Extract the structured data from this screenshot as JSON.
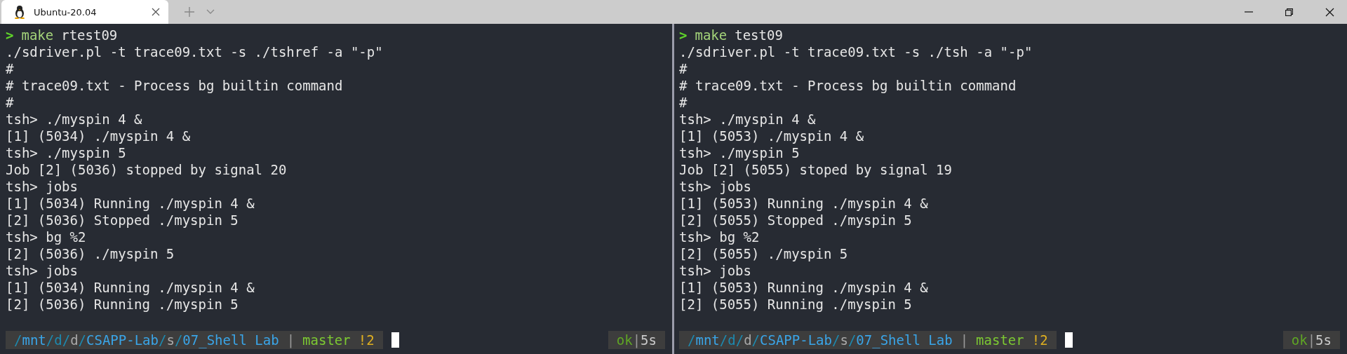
{
  "tab": {
    "title": "Ubuntu-20.04",
    "selected": true
  },
  "panes": [
    {
      "command": {
        "arrow": ">",
        "program": "make",
        "args": "rtest09"
      },
      "output": [
        "./sdriver.pl -t trace09.txt -s ./tshref -a \"-p\"",
        "#",
        "# trace09.txt - Process bg builtin command",
        "#",
        "tsh> ./myspin 4 &",
        "[1] (5034) ./myspin 4 &",
        "tsh> ./myspin 5",
        "Job [2] (5036) stopped by signal 20",
        "tsh> jobs",
        "[1] (5034) Running ./myspin 4 &",
        "[2] (5036) Stopped ./myspin 5",
        "tsh> bg %2",
        "[2] (5036) ./myspin 5",
        "tsh> jobs",
        "[1] (5034) Running ./myspin 4 &",
        "[2] (5036) Running ./myspin 5"
      ],
      "prompt": {
        "segments": [
          {
            "text": "/",
            "color": "#1d8ab0"
          },
          {
            "text": "mnt",
            "color": "#3aa5e8"
          },
          {
            "text": "/",
            "color": "#1d8ab0"
          },
          {
            "text": "d",
            "color": "#1d8ab0"
          },
          {
            "text": "/",
            "color": "#1d8ab0"
          },
          {
            "text": "d",
            "color": "#a8a8a8"
          },
          {
            "text": "/",
            "color": "#1d8ab0"
          },
          {
            "text": "CSAPP-Lab",
            "color": "#3aa5e8"
          },
          {
            "text": "/",
            "color": "#1d8ab0"
          },
          {
            "text": "s",
            "color": "#a8a8a8"
          },
          {
            "text": "/",
            "color": "#1d8ab0"
          },
          {
            "text": "07_Shell Lab",
            "color": "#3aa5e8"
          },
          {
            "text": "|",
            "color": "#9a9a9a"
          },
          {
            "text": "master",
            "color": "#7cc832"
          },
          {
            "text": "!2",
            "color": "#e0b020"
          }
        ],
        "status": [
          {
            "text": "ok",
            "color": "#5fa624"
          },
          {
            "text": "|",
            "color": "#9a9a9a"
          },
          {
            "text": "5s",
            "color": "#c8c8c8"
          }
        ]
      }
    },
    {
      "command": {
        "arrow": ">",
        "program": "make",
        "args": "test09"
      },
      "output": [
        "./sdriver.pl -t trace09.txt -s ./tsh -a \"-p\"",
        "#",
        "# trace09.txt - Process bg builtin command",
        "#",
        "tsh> ./myspin 4 &",
        "[1] (5053) ./myspin 4 &",
        "tsh> ./myspin 5",
        "Job [2] (5055) stoped by signal 19",
        "tsh> jobs",
        "[1] (5053) Running ./myspin 4 &",
        "[2] (5055) Stopped ./myspin 5",
        "tsh> bg %2",
        "[2] (5055) ./myspin 5",
        "tsh> jobs",
        "[1] (5053) Running ./myspin 4 &",
        "[2] (5055) Running ./myspin 5"
      ],
      "prompt": {
        "segments": [
          {
            "text": "/",
            "color": "#1d8ab0"
          },
          {
            "text": "mnt",
            "color": "#3aa5e8"
          },
          {
            "text": "/",
            "color": "#1d8ab0"
          },
          {
            "text": "d",
            "color": "#1d8ab0"
          },
          {
            "text": "/",
            "color": "#1d8ab0"
          },
          {
            "text": "d",
            "color": "#a8a8a8"
          },
          {
            "text": "/",
            "color": "#1d8ab0"
          },
          {
            "text": "CSAPP-Lab",
            "color": "#3aa5e8"
          },
          {
            "text": "/",
            "color": "#1d8ab0"
          },
          {
            "text": "s",
            "color": "#a8a8a8"
          },
          {
            "text": "/",
            "color": "#1d8ab0"
          },
          {
            "text": "07_Shell Lab",
            "color": "#3aa5e8"
          },
          {
            "text": "|",
            "color": "#9a9a9a"
          },
          {
            "text": "master",
            "color": "#7cc832"
          },
          {
            "text": "!2",
            "color": "#e0b020"
          }
        ],
        "status": [
          {
            "text": "ok",
            "color": "#5fa624"
          },
          {
            "text": "|",
            "color": "#9a9a9a"
          },
          {
            "text": "5s",
            "color": "#c8c8c8"
          }
        ]
      }
    }
  ]
}
